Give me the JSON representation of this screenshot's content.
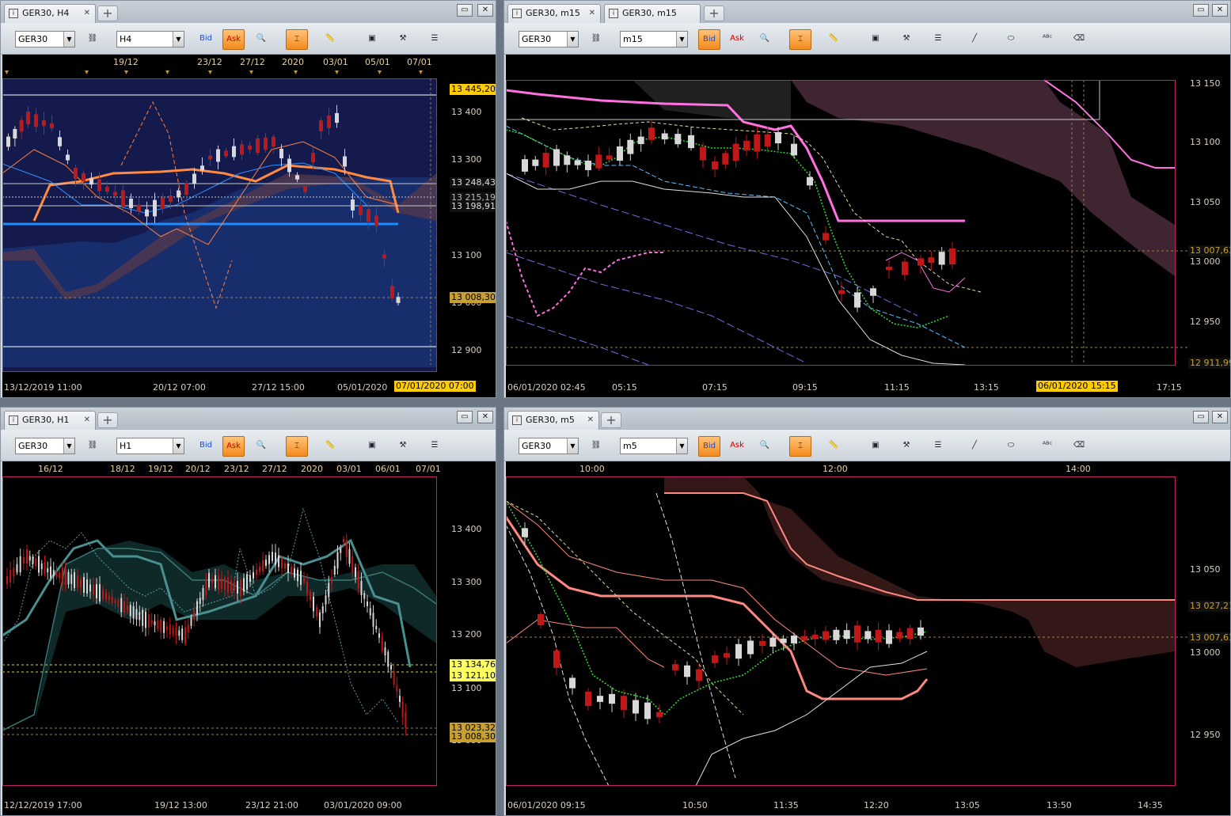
{
  "windows": [
    {
      "tabs": [
        "GER30, H4"
      ],
      "symbol": "GER30",
      "timeframe": "H4",
      "bid_label": "Bid",
      "ask_label": "Ask",
      "top_dates": [
        "19/12",
        "23/12",
        "27/12",
        "2020",
        "03/01",
        "05/01",
        "07/01"
      ],
      "price_ticks": [
        "13 400",
        "13 300",
        "13 100",
        "13 000",
        "12 900"
      ],
      "price_labels": [
        "13 445,20",
        "13 248,43",
        "13 215,19",
        "13 198,91",
        "13 008,30"
      ],
      "time_labels": [
        "13/12/2019 11:00",
        "20/12 07:00",
        "27/12 15:00",
        "05/01/2020"
      ],
      "cursor_time": "07/01/2020 07:00"
    },
    {
      "tabs": [
        "GER30, m15",
        "GER30, m15"
      ],
      "symbol": "GER30",
      "timeframe": "m15",
      "bid_label": "Bid",
      "ask_label": "Ask",
      "price_ticks": [
        "13 150",
        "13 100",
        "13 050",
        "13 000",
        "12 950"
      ],
      "price_labels": [
        "13 007,63",
        "12 911,99"
      ],
      "time_labels": [
        "06/01/2020 02:45",
        "05:15",
        "07:15",
        "09:15",
        "11:15",
        "13:15",
        "17:15"
      ],
      "cursor_time": "06/01/2020 15:15"
    },
    {
      "tabs": [
        "GER30, H1"
      ],
      "symbol": "GER30",
      "timeframe": "H1",
      "bid_label": "Bid",
      "ask_label": "Ask",
      "top_dates": [
        "16/12",
        "18/12",
        "19/12",
        "20/12",
        "23/12",
        "27/12",
        "2020",
        "03/01",
        "06/01",
        "07/01"
      ],
      "price_ticks": [
        "13 400",
        "13 300",
        "13 200",
        "13 100",
        "13 000"
      ],
      "price_labels": [
        "13 134,76",
        "13 121,10",
        "13 023,32",
        "13 008,30"
      ],
      "time_labels": [
        "12/12/2019 17:00",
        "19/12 13:00",
        "23/12 21:00",
        "03/01/2020 09:00"
      ]
    },
    {
      "tabs": [
        "GER30, m5"
      ],
      "symbol": "GER30",
      "timeframe": "m5",
      "bid_label": "Bid",
      "ask_label": "Ask",
      "top_dates": [
        "10:00",
        "12:00",
        "14:00"
      ],
      "price_ticks": [
        "13 050",
        "13 000",
        "12 950"
      ],
      "price_labels": [
        "13 027,21",
        "13 007,63"
      ],
      "time_labels": [
        "06/01/2020 09:15",
        "10:50",
        "11:35",
        "12:20",
        "13:05",
        "13:50",
        "14:35"
      ]
    }
  ],
  "icons": [
    "window-icon",
    "link-icon",
    "zoom-icon",
    "magnet-icon",
    "ruler-icon",
    "picture-icon",
    "tools-icon",
    "indicator-icon",
    "line-icon",
    "ellipse-icon",
    "text-icon",
    "eraser-icon"
  ],
  "colors": {
    "accent": "#f38a1c",
    "bg": "#000000",
    "frame": "#c0206a",
    "price_label": "#ffcc00"
  }
}
